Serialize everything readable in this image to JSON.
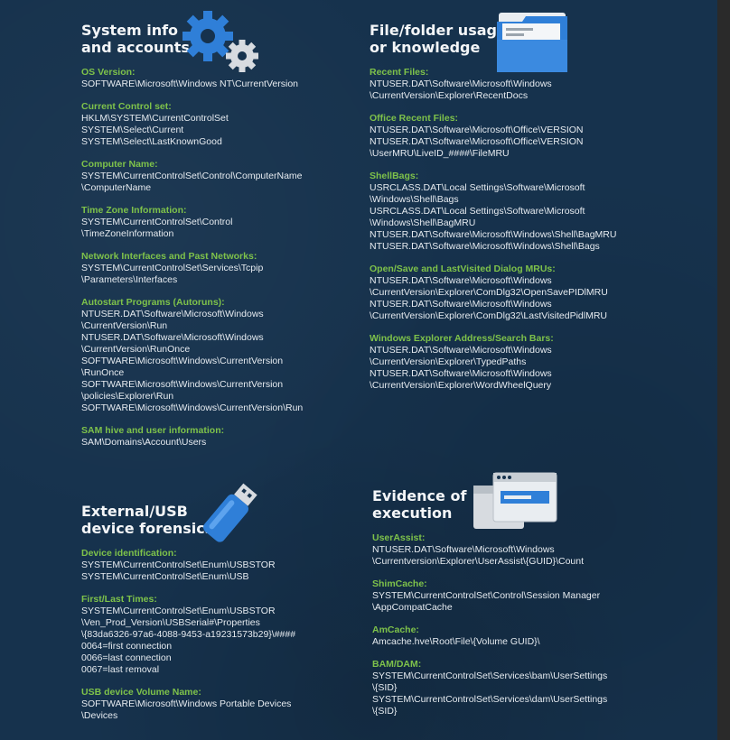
{
  "colors": {
    "background": "#16324d",
    "label": "#7ec24a",
    "text": "#e6ebf0",
    "heading": "#f4f6f8"
  },
  "sections": {
    "system": {
      "title_lines": [
        "System info",
        "and accounts"
      ],
      "icon": "gears-icon",
      "items": [
        {
          "label": "OS Version:",
          "lines": [
            "SOFTWARE\\Microsoft\\Windows NT\\CurrentVersion"
          ]
        },
        {
          "label": "Current Control set:",
          "lines": [
            "HKLM\\SYSTEM\\CurrentControlSet",
            "SYSTEM\\Select\\Current",
            "SYSTEM\\Select\\LastKnownGood"
          ]
        },
        {
          "label": "Computer Name:",
          "lines": [
            "SYSTEM\\CurrentControlSet\\Control\\ComputerName",
            "\\ComputerName"
          ]
        },
        {
          "label": "Time Zone Information:",
          "lines": [
            "SYSTEM\\CurrentControlSet\\Control",
            "\\TimeZoneInformation"
          ]
        },
        {
          "label": "Network Interfaces and Past Networks:",
          "lines": [
            "SYSTEM\\CurrentControlSet\\Services\\Tcpip",
            "\\Parameters\\Interfaces"
          ]
        },
        {
          "label": "Autostart Programs (Autoruns):",
          "lines": [
            "NTUSER.DAT\\Software\\Microsoft\\Windows",
            "\\CurrentVersion\\Run",
            "NTUSER.DAT\\Software\\Microsoft\\Windows",
            "\\CurrentVersion\\RunOnce",
            "SOFTWARE\\Microsoft\\Windows\\CurrentVersion",
            "\\RunOnce",
            "SOFTWARE\\Microsoft\\Windows\\CurrentVersion",
            "\\policies\\Explorer\\Run",
            "SOFTWARE\\Microsoft\\Windows\\CurrentVersion\\Run"
          ]
        },
        {
          "label": "SAM hive and user information:",
          "lines": [
            "SAM\\Domains\\Account\\Users"
          ]
        }
      ]
    },
    "files": {
      "title_lines": [
        "File/folder usage",
        "or knowledge"
      ],
      "icon": "folder-icon",
      "items": [
        {
          "label": "Recent Files:",
          "lines": [
            "NTUSER.DAT\\Software\\Microsoft\\Windows",
            "\\CurrentVersion\\Explorer\\RecentDocs"
          ]
        },
        {
          "label": "Office Recent Files:",
          "lines": [
            "NTUSER.DAT\\Software\\Microsoft\\Office\\VERSION",
            "NTUSER.DAT\\Software\\Microsoft\\Office\\VERSION",
            "\\UserMRU\\LiveID_####\\FileMRU"
          ]
        },
        {
          "label": "ShellBags:",
          "lines": [
            "USRCLASS.DAT\\Local Settings\\Software\\Microsoft",
            "\\Windows\\Shell\\Bags",
            "USRCLASS.DAT\\Local Settings\\Software\\Microsoft",
            "\\Windows\\Shell\\BagMRU",
            "NTUSER.DAT\\Software\\Microsoft\\Windows\\Shell\\BagMRU",
            "NTUSER.DAT\\Software\\Microsoft\\Windows\\Shell\\Bags"
          ]
        },
        {
          "label": "Open/Save and LastVisited Dialog MRUs:",
          "lines": [
            "NTUSER.DAT\\Software\\Microsoft\\Windows",
            "\\CurrentVersion\\Explorer\\ComDlg32\\OpenSavePIDlMRU",
            "NTUSER.DAT\\Software\\Microsoft\\Windows",
            "\\CurrentVersion\\Explorer\\ComDlg32\\LastVisitedPidlMRU"
          ]
        },
        {
          "label": "Windows Explorer Address/Search Bars:",
          "lines": [
            "NTUSER.DAT\\Software\\Microsoft\\Windows",
            "\\CurrentVersion\\Explorer\\TypedPaths",
            "NTUSER.DAT\\Software\\Microsoft\\Windows",
            "\\CurrentVersion\\Explorer\\WordWheelQuery"
          ]
        }
      ]
    },
    "usb": {
      "title_lines": [
        "External/USB",
        "device forensics"
      ],
      "icon": "usb-drive-icon",
      "items": [
        {
          "label": "Device identification:",
          "lines": [
            "SYSTEM\\CurrentControlSet\\Enum\\USBSTOR",
            "SYSTEM\\CurrentControlSet\\Enum\\USB"
          ]
        },
        {
          "label": "First/Last Times:",
          "lines": [
            "SYSTEM\\CurrentControlSet\\Enum\\USBSTOR",
            "\\Ven_Prod_Version\\USBSerial#\\Properties",
            "\\{83da6326-97a6-4088-9453-a19231573b29}\\####",
            "0064=first connection",
            "0066=last connection",
            "0067=last removal"
          ]
        },
        {
          "label": "USB device Volume Name:",
          "lines": [
            "SOFTWARE\\Microsoft\\Windows Portable Devices",
            "\\Devices"
          ]
        }
      ]
    },
    "exec": {
      "title_lines": [
        "Evidence of",
        "execution"
      ],
      "icon": "app-windows-icon",
      "items": [
        {
          "label": "UserAssist:",
          "lines": [
            "NTUSER.DAT\\Software\\Microsoft\\Windows",
            "\\Currentversion\\Explorer\\UserAssist\\{GUID}\\Count"
          ]
        },
        {
          "label": "ShimCache:",
          "lines": [
            "SYSTEM\\CurrentControlSet\\Control\\Session Manager",
            "\\AppCompatCache"
          ]
        },
        {
          "label": "AmCache:",
          "lines": [
            "Amcache.hve\\Root\\File\\{Volume GUID}\\"
          ]
        },
        {
          "label": "BAM/DAM:",
          "lines": [
            "SYSTEM\\CurrentControlSet\\Services\\bam\\UserSettings",
            "\\{SID}",
            "SYSTEM\\CurrentControlSet\\Services\\dam\\UserSettings",
            "\\{SID}"
          ]
        }
      ]
    }
  }
}
